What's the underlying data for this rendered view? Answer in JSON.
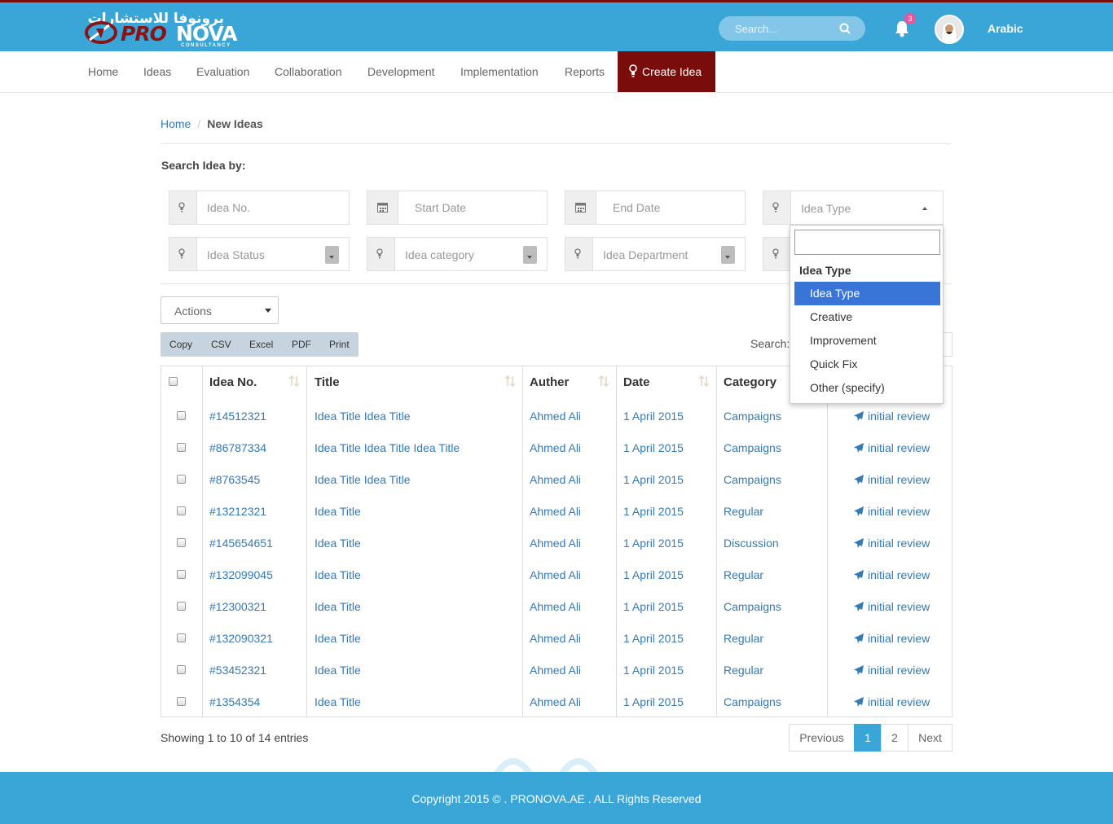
{
  "header": {
    "logo_arabic": "برونوفا للاستشارات",
    "logo_pro": "PRO",
    "logo_nova": "NOVA",
    "logo_sub": "CONSULTANCY",
    "search_placeholder": "Search...",
    "notification_count": "3",
    "language": "Arabic",
    "colors": {
      "bar": "#3aa6d8",
      "accent": "#7a0c0c"
    }
  },
  "nav": {
    "items": [
      "Home",
      "Ideas",
      "Evaluation",
      "Collaboration",
      "Development",
      "Implementation",
      "Reports"
    ],
    "create_label": "Create Idea"
  },
  "breadcrumb": {
    "home": "Home",
    "sep": "/",
    "current": "New Ideas"
  },
  "filters": {
    "title": "Search Idea by:",
    "idea_no": "Idea No.",
    "start_date": "Start Date",
    "end_date": "End Date",
    "idea_type": "Idea Type",
    "idea_status": "Idea Status",
    "idea_category": "Idea category",
    "idea_department": "Idea Department"
  },
  "dropdown": {
    "group_label": "Idea Type",
    "options": [
      "Idea Type",
      "Creative",
      "Improvement",
      "Quick Fix",
      "Other (specify)"
    ],
    "selected": "Idea Type"
  },
  "toolbar": {
    "actions_label": "Actions",
    "buttons": [
      "Copy",
      "CSV",
      "Excel",
      "PDF",
      "Print"
    ],
    "search_label": "Search:"
  },
  "table": {
    "headers": [
      "Idea No.",
      "Title",
      "Auther",
      "Date",
      "Category"
    ],
    "rows": [
      [
        "#14512321",
        "Idea Title Idea Title",
        "Ahmed Ali",
        "1 April 2015",
        "Campaigns",
        "initial review"
      ],
      [
        "#86787334",
        "Idea Title Idea Title Idea Title",
        "Ahmed Ali",
        "1 April 2015",
        "Campaigns",
        "initial review"
      ],
      [
        "#8763545",
        "Idea Title Idea Title",
        "Ahmed Ali",
        "1 April 2015",
        "Campaigns",
        "initial review"
      ],
      [
        "#13212321",
        "Idea Title",
        "Ahmed Ali",
        "1 April 2015",
        "Regular",
        "initial review"
      ],
      [
        "#145654651",
        "Idea Title",
        "Ahmed Ali",
        "1 April 2015",
        "Discussion",
        "initial review"
      ],
      [
        "#132099045",
        "Idea Title",
        "Ahmed Ali",
        "1 April 2015",
        "Regular",
        "initial review"
      ],
      [
        "#12300321",
        "Idea Title",
        "Ahmed Ali",
        "1 April 2015",
        "Campaigns",
        "initial review"
      ],
      [
        "#132090321",
        "Idea Title",
        "Ahmed Ali",
        "1 April 2015",
        "Regular",
        "initial review"
      ],
      [
        "#53452321",
        "Idea Title",
        "Ahmed Ali",
        "1 April 2015",
        "Regular",
        "initial review"
      ],
      [
        "#1354354",
        "Idea Title",
        "Ahmed Ali",
        "1 April 2015",
        "Campaigns",
        "initial review"
      ]
    ]
  },
  "pagination": {
    "info": "Showing 1 to 10 of 14 entries",
    "previous": "Previous",
    "pages": [
      "1",
      "2"
    ],
    "current": "1",
    "next": "Next"
  },
  "footer": {
    "copyright": "Copyright 2015 © . PRONOVA.AE . ALL Rights Reserved"
  }
}
